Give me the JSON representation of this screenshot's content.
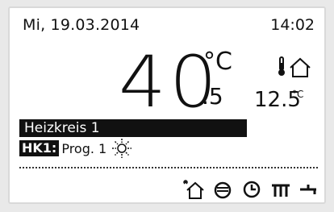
{
  "header": {
    "date": "Mi, 19.03.2014",
    "time": "14:02"
  },
  "room_temperature": {
    "integer": "40",
    "unit": "°C",
    "decimal": ".5"
  },
  "outside_temperature": {
    "value": "12.5",
    "unit": "°C",
    "icon": "outside-thermometer-house-icon"
  },
  "heating_circuit": {
    "title": "Heizkreis 1",
    "tag": "HK1:",
    "program": "Prog. 1",
    "mode_icon": "sun-icon"
  },
  "bottom_icons": [
    "solar-house-icon",
    "boiler-icon",
    "clock-icon",
    "radiator-icon",
    "hot-water-tap-icon"
  ],
  "colors": {
    "background": "#ffffff",
    "foreground": "#111111",
    "bezel": "#e9e9e9"
  }
}
